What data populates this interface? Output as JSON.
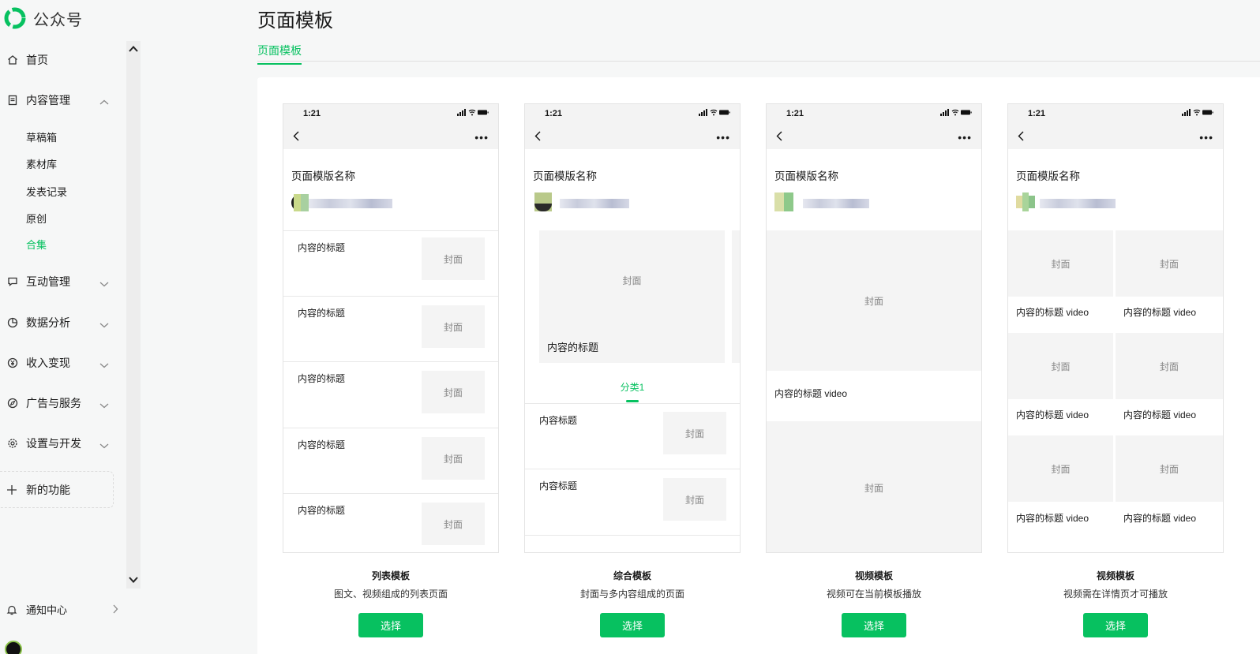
{
  "app": {
    "brand": "公众号",
    "brand_color": "#07c160"
  },
  "sidebar": {
    "items": [
      {
        "label": "首页",
        "icon": "home-icon"
      },
      {
        "label": "内容管理",
        "icon": "document-icon",
        "expanded": true
      },
      {
        "label": "互动管理",
        "icon": "comment-icon"
      },
      {
        "label": "数据分析",
        "icon": "pie-chart-icon"
      },
      {
        "label": "收入变现",
        "icon": "yen-icon"
      },
      {
        "label": "广告与服务",
        "icon": "compass-icon"
      },
      {
        "label": "设置与开发",
        "icon": "gear-icon"
      }
    ],
    "sub_items": [
      "草稿箱",
      "素材库",
      "发表记录",
      "原创",
      "合集"
    ],
    "active_sub": "合集",
    "new_feature": "新的功能",
    "notice": "通知中心"
  },
  "page": {
    "title": "页面模板",
    "tab": "页面模板"
  },
  "phone": {
    "time": "1:21",
    "template_name": "页面模版名称"
  },
  "cards": [
    {
      "title": "列表模板",
      "desc": "图文、视频组成的列表页面",
      "button": "选择",
      "rows": [
        "内容的标题",
        "内容的标题",
        "内容的标题",
        "内容的标题",
        "内容的标题"
      ],
      "cover": "封面"
    },
    {
      "title": "综合模板",
      "desc": "封面与多内容组成的页面",
      "button": "选择",
      "hero_cover": "封面",
      "hero_title": "内容的标题",
      "category": "分类1",
      "rows": [
        "内容标题",
        "内容标题"
      ],
      "cover": "封面"
    },
    {
      "title": "视频模板",
      "desc": "视频可在当前模板播放",
      "button": "选择",
      "cover1": "封面",
      "video_title": "内容的标题 video",
      "cover2": "封面"
    },
    {
      "title": "视频模板",
      "desc": "视频需在详情页才可播放",
      "button": "选择",
      "grid": [
        {
          "cover": "封面",
          "title": "内容的标题 video"
        },
        {
          "cover": "封面",
          "title": "内容的标题 video"
        },
        {
          "cover": "封面",
          "title": "内容的标题 video"
        },
        {
          "cover": "封面",
          "title": "内容的标题 video"
        },
        {
          "cover": "封面",
          "title": "内容的标题 video"
        },
        {
          "cover": "封面",
          "title": "内容的标题 video"
        }
      ]
    }
  ]
}
